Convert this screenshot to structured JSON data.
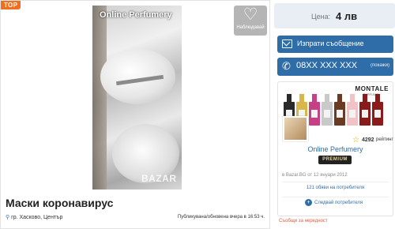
{
  "listing": {
    "top_badge": "TOP",
    "photo_caption": "Online Perfumery",
    "photo_watermark": "BAZAR",
    "title": "Маски коронавирус",
    "location": "гр. Хасково, Център",
    "published": "Публикувана/обновена вчера в 16:53 ч."
  },
  "favorite": {
    "label": "Наблюдавай",
    "icon": "heart-icon"
  },
  "price": {
    "label": "Цена:",
    "value": "4 лв"
  },
  "actions": {
    "message_label": "Изпрати съобщение",
    "message_icon": "envelope-icon",
    "phone_label": "08XX XXX XXX",
    "phone_sub": "(покажи)",
    "phone_icon": "phone-icon"
  },
  "user": {
    "banner_brand": "MONTALE",
    "banner_brand_sub": "PARFUMS",
    "rating_value": "4292",
    "rating_label": "рейтинг",
    "name": "Online Perfumery",
    "premium_label": "PREMIUM",
    "since": "в Bazar.BG от 12 януари 2012",
    "ads_link": "121 обяви на потребителя",
    "follow_label": "Следвай потребителя"
  },
  "footer": {
    "report": "Съобщи за нередност"
  },
  "colors": {
    "accent": "#2f6da8",
    "top_badge": "#f26f21",
    "report": "#e05a3c",
    "bottles": [
      "#2a2a2a",
      "#d9b64a",
      "#c93f86",
      "#c9c9c9",
      "#6b3a23",
      "#f2c3c6",
      "#8b1a1a",
      "#8b1a1a"
    ]
  }
}
